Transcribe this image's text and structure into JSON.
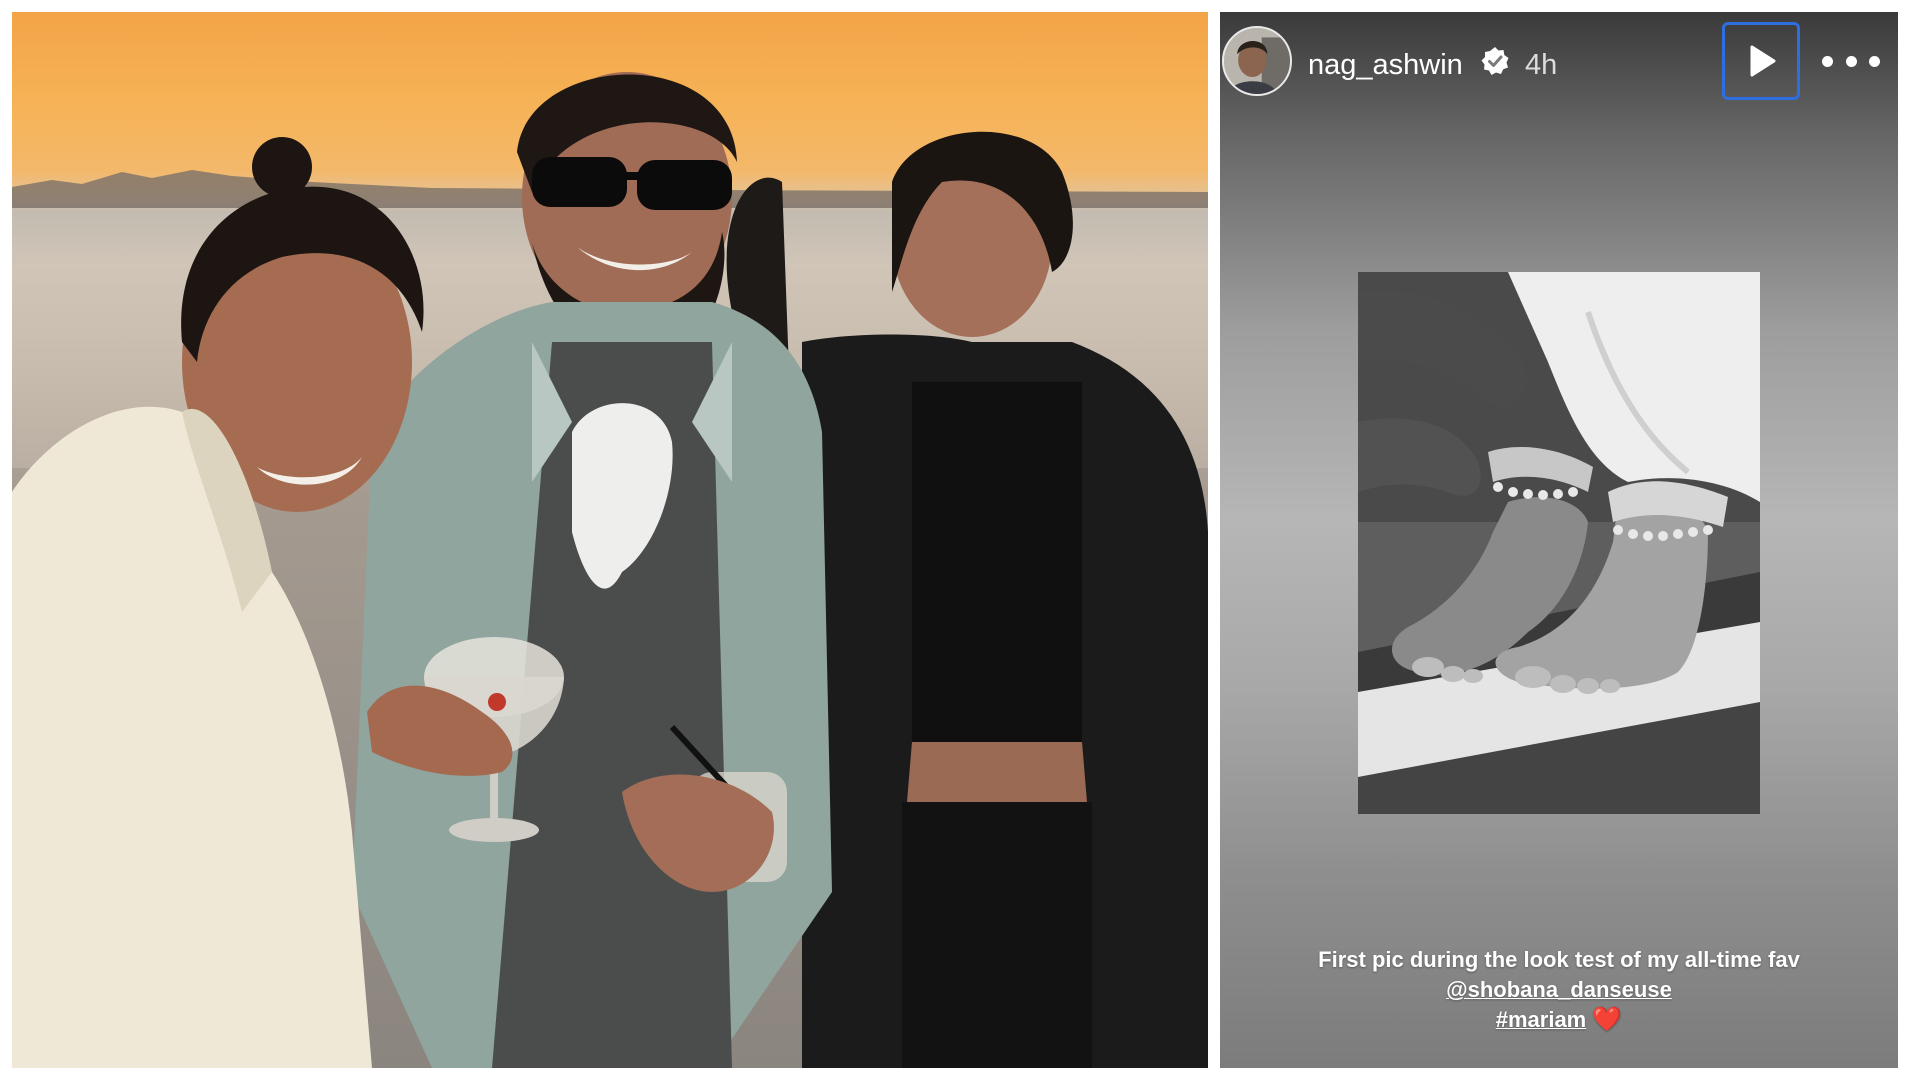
{
  "story": {
    "username": "nag_ashwin",
    "time_ago": "4h",
    "caption_line1": "First pic during the look test of my all-time fav",
    "caption_mention": "@shobana_danseuse",
    "caption_hashtag": "#mariam",
    "caption_emoji": "❤️"
  },
  "icons": {
    "verified": "verified-badge-icon",
    "play": "play-icon",
    "more": "more-options-icon"
  },
  "colors": {
    "focus_outline": "#2d6ee0",
    "verified_badge": "#ffffff",
    "heart": "#e8322f"
  }
}
